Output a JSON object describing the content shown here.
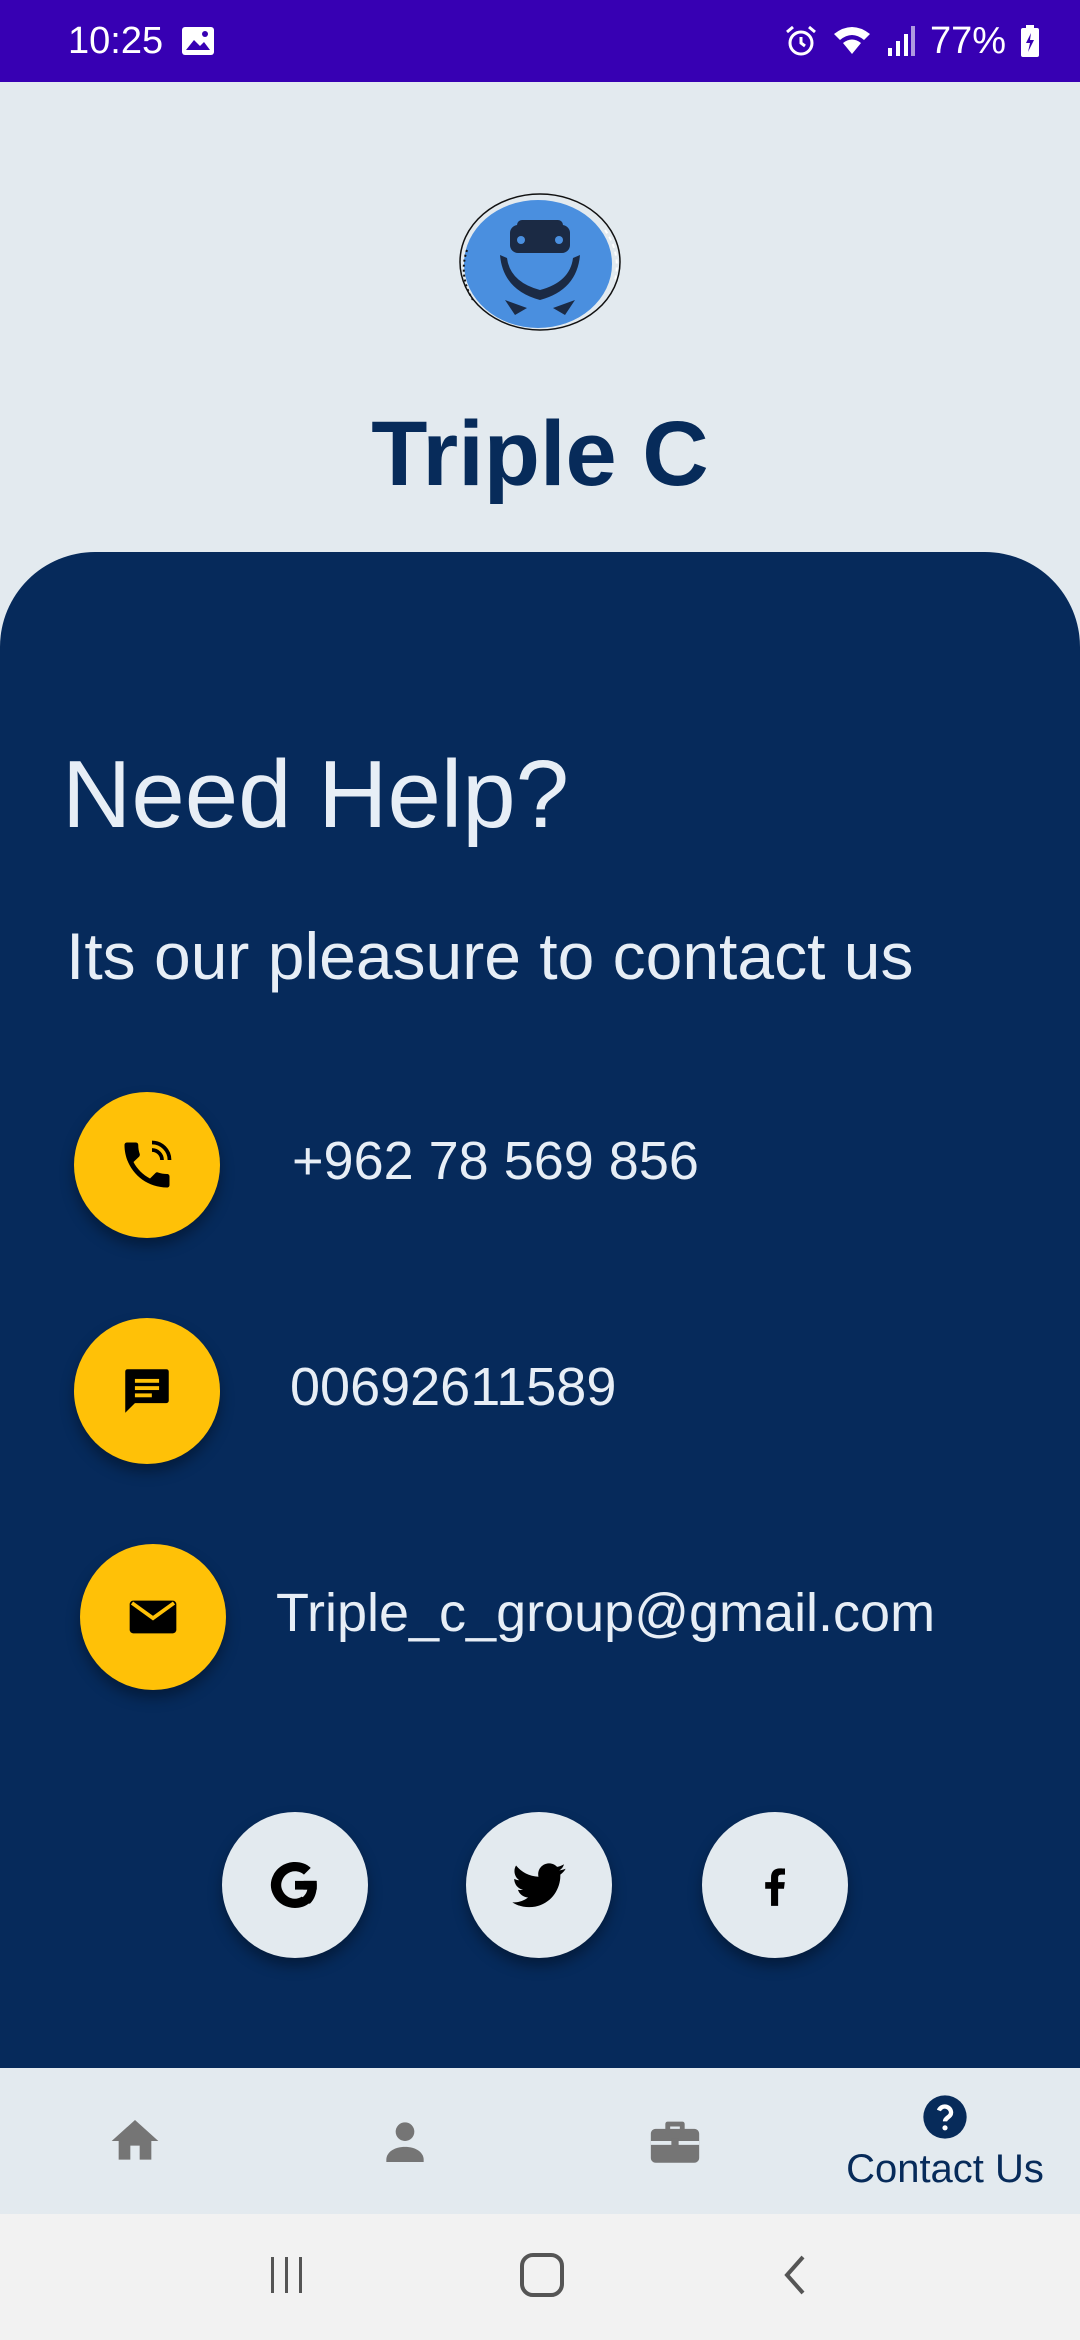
{
  "status_bar": {
    "time": "10:25",
    "battery": "77%",
    "icons": [
      "image-icon",
      "alarm-icon",
      "wifi-icon",
      "signal-icon",
      "battery-icon"
    ]
  },
  "header": {
    "title": "Triple C",
    "logo": "car-in-hands-logo"
  },
  "help": {
    "title": "Need Help?",
    "subtitle": "Its our pleasure to contact us"
  },
  "contacts": {
    "phone": "+962 78 569 856",
    "message": "00692611589",
    "email": "Triple_c_group@gmail.com"
  },
  "social": [
    "google-icon",
    "twitter-icon",
    "facebook-icon"
  ],
  "bottom_nav": {
    "items": [
      "home-icon",
      "profile-icon",
      "briefcase-icon",
      "help-icon"
    ],
    "active_label": "Contact Us"
  },
  "colors": {
    "primary": "#062a5b",
    "accent": "#ffc107",
    "status_bar": "#3700b3",
    "background": "#e3eaef"
  }
}
